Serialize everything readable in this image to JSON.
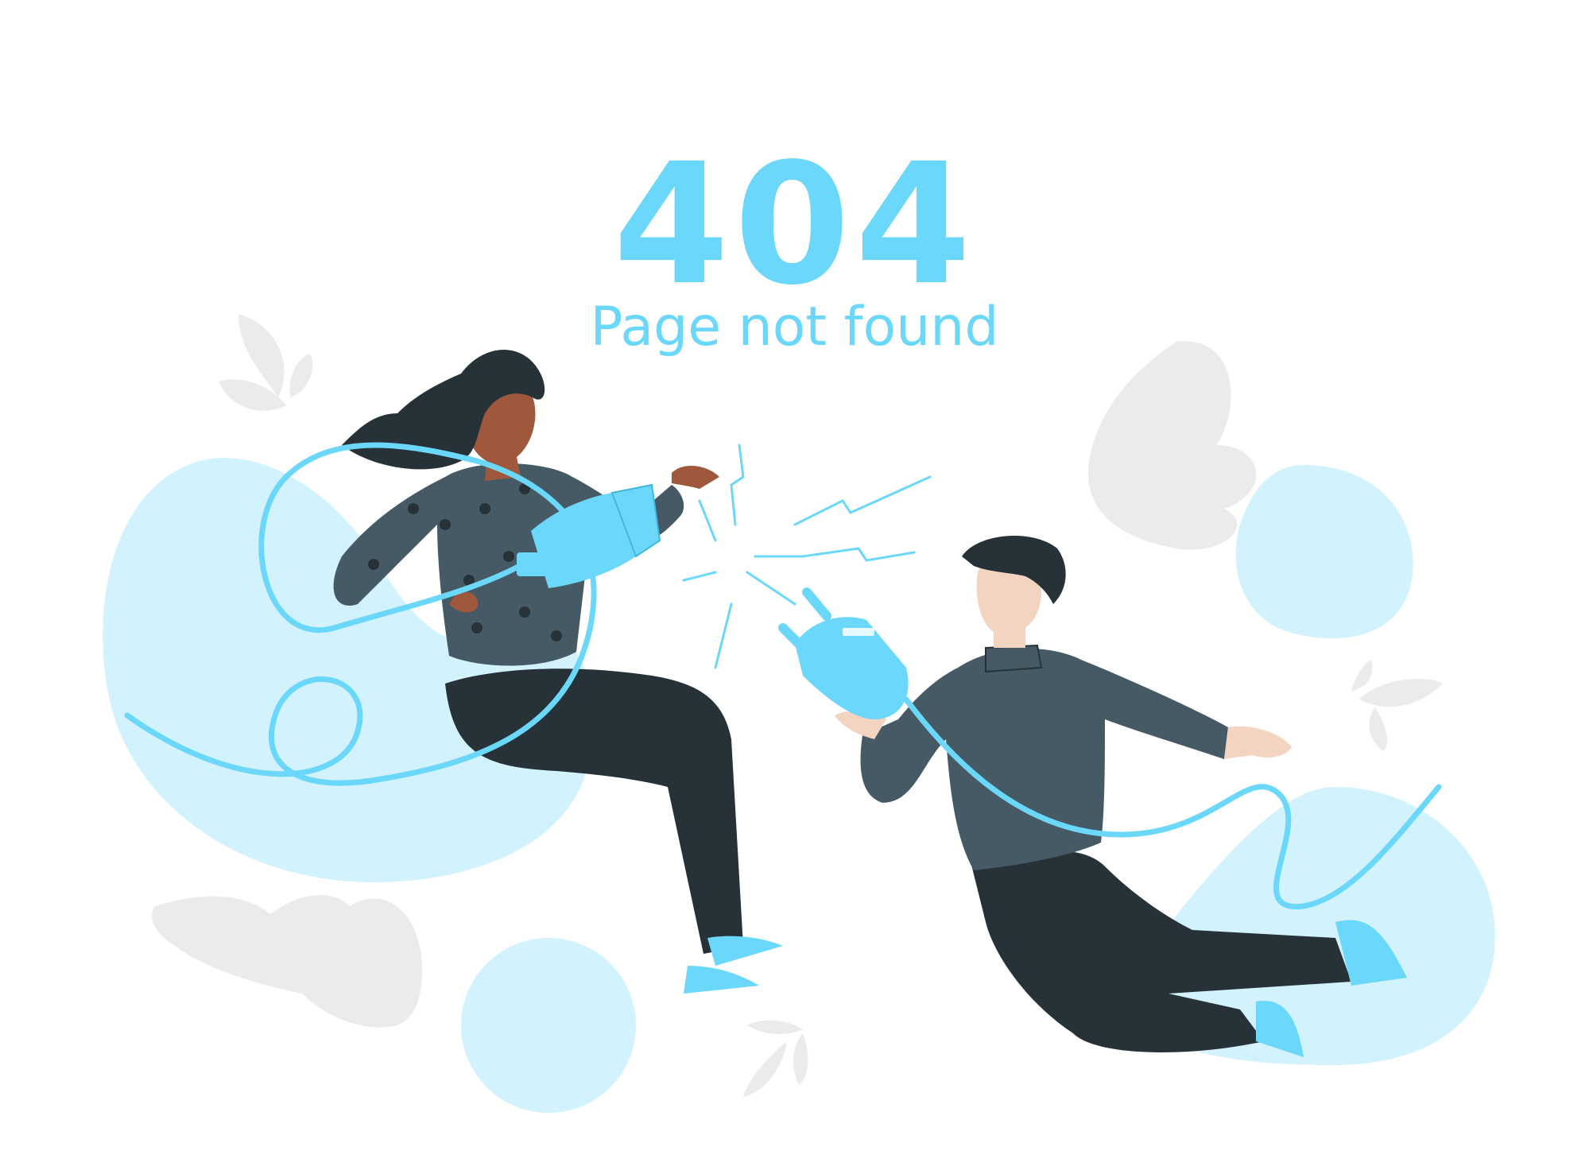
{
  "error": {
    "code": "404",
    "message": "Page not found"
  },
  "colors": {
    "accent": "#6ad7fb",
    "blob": "#d2f3fd",
    "leaf": "#ebebeb",
    "sweater": "#455a64",
    "pants": "#263238",
    "skin_dark": "#a0583d",
    "skin_light": "#f3d4c0",
    "hair": "#263238"
  },
  "icons": [
    "plug-icon",
    "leaf-icon",
    "spark-icon"
  ]
}
